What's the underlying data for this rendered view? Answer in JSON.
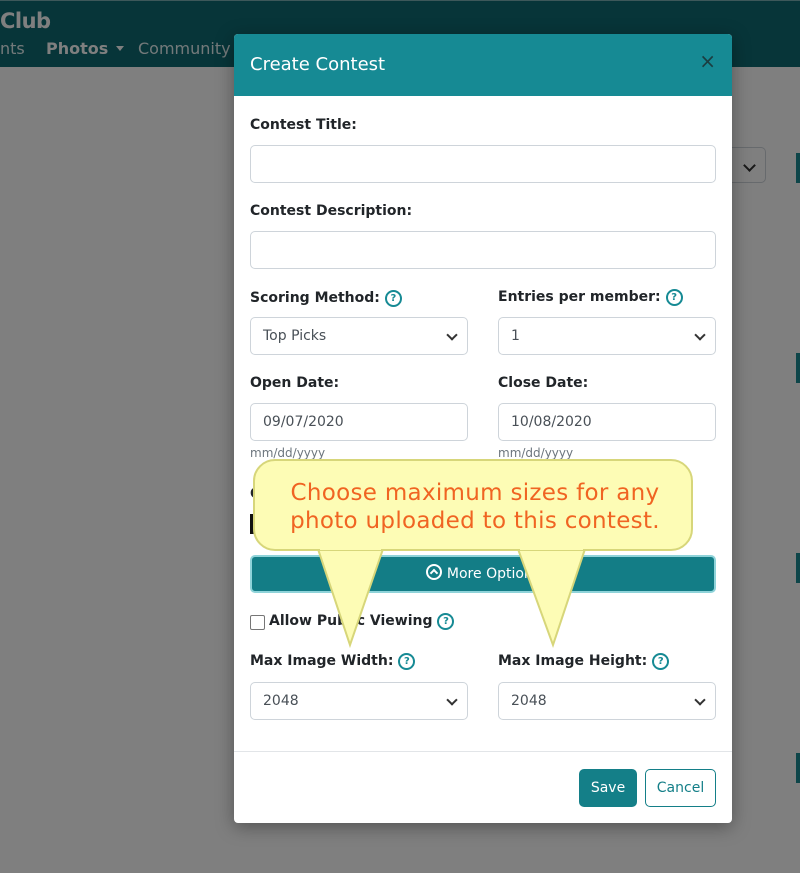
{
  "navbar": {
    "brand": "Club",
    "items": [
      {
        "label": "nts"
      },
      {
        "label": "Photos"
      },
      {
        "label": "Community"
      }
    ]
  },
  "modal": {
    "title": "Create Contest",
    "close_symbol": "×",
    "contest_title": {
      "label": "Contest Title:",
      "value": ""
    },
    "contest_description": {
      "label": "Contest Description:",
      "value": ""
    },
    "scoring_method": {
      "label": "Scoring Method:",
      "value": "Top Picks"
    },
    "entries_per_member": {
      "label": "Entries per member:",
      "value": "1"
    },
    "open_date": {
      "label": "Open Date:",
      "value": "09/07/2020",
      "hint": "mm/dd/yyyy"
    },
    "close_date": {
      "label": "Close Date:",
      "value": "10/08/2020",
      "hint": "mm/dd/yyyy"
    },
    "partial_label": "C",
    "more_options_label": "More Options",
    "allow_public_viewing": {
      "label": "Allow Public Viewing",
      "checked": false
    },
    "max_image_width": {
      "label": "Max Image Width:",
      "value": "2048"
    },
    "max_image_height": {
      "label": "Max Image Height:",
      "value": "2048"
    },
    "save_label": "Save",
    "cancel_label": "Cancel"
  },
  "callout": {
    "line1": "Choose maximum sizes for any",
    "line2": "photo uploaded to this contest."
  },
  "colors": {
    "primary": "#168a94",
    "navbar": "#0f6b73",
    "callout_bg": "#fdfcb5",
    "callout_text": "#f06422"
  },
  "icons": {
    "help": "question-circle-icon",
    "close": "close-icon",
    "more_options": "chevron-circle-up-icon",
    "select_arrow": "chevron-down-icon"
  }
}
